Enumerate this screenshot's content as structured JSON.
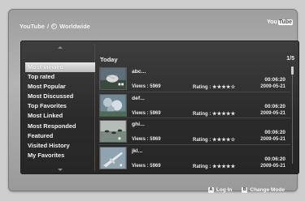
{
  "header": {
    "breadcrumb_app": "YouTube",
    "breadcrumb_sep": "/",
    "breadcrumb_region": "Worldwide",
    "logo_you": "You",
    "logo_tube": "Tube"
  },
  "sidebar": {
    "items": [
      {
        "label": "Most viewed",
        "selected": true
      },
      {
        "label": "Top rated"
      },
      {
        "label": "Most Popular"
      },
      {
        "label": "Most Discussed"
      },
      {
        "label": "Top Favorites"
      },
      {
        "label": "Most Linked"
      },
      {
        "label": "Most Responded"
      },
      {
        "label": "Featured"
      },
      {
        "label": "Visited History"
      },
      {
        "label": "My Favorites"
      }
    ]
  },
  "main": {
    "section_title": "Today",
    "page_indicator": "1/5",
    "videos": [
      {
        "title": "abc...",
        "duration": "00:06:20",
        "views": "Views : 5969",
        "rating_label": "Rating :",
        "stars": "★★★★☆",
        "date": "2009-05-21",
        "thumb": "bird"
      },
      {
        "title": "def...",
        "duration": "00:06:20",
        "views": "Views : 5969",
        "rating_label": "Rating :",
        "stars": "★★★★★",
        "date": "2009-05-21",
        "thumb": "flowers"
      },
      {
        "title": "ghi...",
        "duration": "00:06:20",
        "views": "Views : 5969",
        "rating_label": "Rating :",
        "stars": "★★★★☆",
        "date": "2009-05-21",
        "thumb": "birds-water"
      },
      {
        "title": "jkl...",
        "duration": "00:06:20",
        "views": "Views : 5969",
        "rating_label": "Rating :",
        "stars": "★★★★★",
        "date": "2009-05-21",
        "thumb": "plane"
      }
    ]
  },
  "hints": {
    "a_key": "A",
    "a_label": "Log In",
    "b_key": "B",
    "b_label": "Change Mode"
  },
  "colors": {
    "frame": "#a8a8a8",
    "panel": "#2e2e2e",
    "selected_item": "#cfcfcf"
  }
}
